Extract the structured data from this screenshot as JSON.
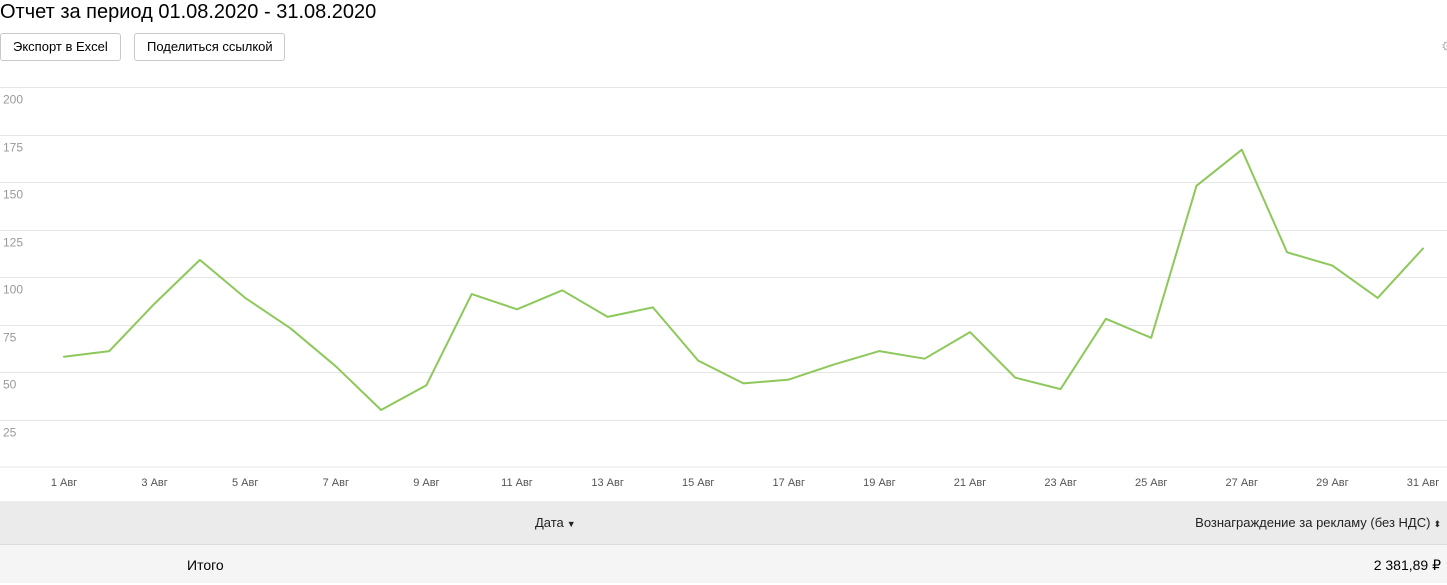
{
  "report": {
    "title": "Отчет за период 01.08.2020 - 31.08.2020"
  },
  "toolbar": {
    "export_label": "Экспорт в Excel",
    "share_label": "Поделиться ссылкой"
  },
  "table": {
    "date_header": "Дата",
    "reward_header": "Вознаграждение за рекламу (без НДС)",
    "total_label": "Итого",
    "total_value": "2 381,89 ₽"
  },
  "chart_data": {
    "type": "line",
    "y_ticks": [
      25,
      50,
      75,
      100,
      125,
      150,
      175,
      200
    ],
    "ylim": [
      0,
      200
    ],
    "grid": true,
    "x": [
      "1 Авг",
      "2 Авг",
      "3 Авг",
      "4 Авг",
      "5 Авг",
      "6 Авг",
      "7 Авг",
      "8 Авг",
      "9 Авг",
      "10 Авг",
      "11 Авг",
      "12 Авг",
      "13 Авг",
      "14 Авг",
      "15 Авг",
      "16 Авг",
      "17 Авг",
      "18 Авг",
      "19 Авг",
      "20 Авг",
      "21 Авг",
      "22 Авг",
      "23 Авг",
      "24 Авг",
      "25 Авг",
      "26 Авг",
      "27 Авг",
      "28 Авг",
      "29 Авг",
      "30 Авг",
      "31 Авг"
    ],
    "x_tick_labels": [
      "1 Авг",
      "3 Авг",
      "5 Авг",
      "7 Авг",
      "9 Авг",
      "11 Авг",
      "13 Авг",
      "15 Авг",
      "17 Авг",
      "19 Авг",
      "21 Авг",
      "23 Авг",
      "25 Авг",
      "27 Авг",
      "29 Авг",
      "31 Авг"
    ],
    "series": [
      {
        "color": "#8dc85a",
        "values": [
          58,
          61,
          86,
          109,
          89,
          73,
          53,
          30,
          43,
          91,
          83,
          93,
          79,
          84,
          56,
          44,
          46,
          54,
          61,
          57,
          71,
          47,
          41,
          78,
          68,
          148,
          167,
          113,
          106,
          89,
          115
        ]
      }
    ]
  }
}
